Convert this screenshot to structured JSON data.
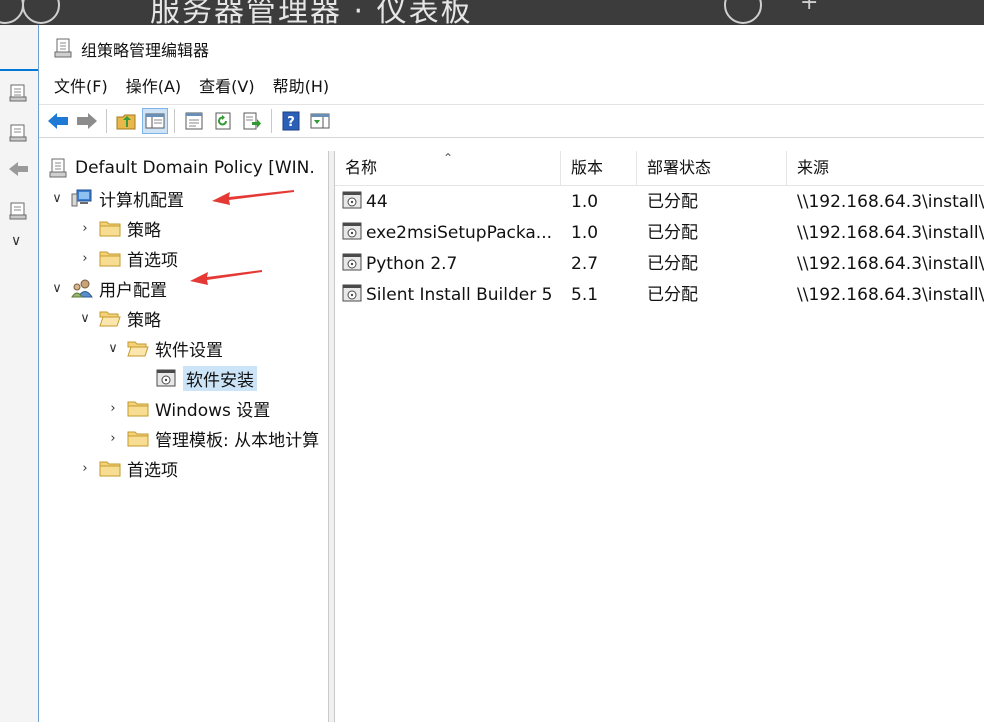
{
  "background_window": {
    "title": "服务器管理器 · 仪表板"
  },
  "window": {
    "title": "组策略管理编辑器"
  },
  "menu": [
    {
      "label": "文件(F)"
    },
    {
      "label": "操作(A)"
    },
    {
      "label": "查看(V)"
    },
    {
      "label": "帮助(H)"
    }
  ],
  "toolbar": {
    "buttons": [
      "back-icon",
      "forward-icon",
      "up-folder-icon",
      "show-hide-tree-icon",
      "properties-icon",
      "refresh-icon",
      "export-list-icon",
      "help-icon",
      "show-action-pane-icon"
    ]
  },
  "tree": {
    "root": "Default Domain Policy [WIN.",
    "computer_config": "计算机配置",
    "cc_policies": "策略",
    "cc_preferences": "首选项",
    "user_config": "用户配置",
    "uc_policies": "策略",
    "software_settings": "软件设置",
    "software_installation": "软件安装",
    "windows_settings": "Windows 设置",
    "admin_templates": "管理模板: 从本地计算",
    "uc_preferences": "首选项"
  },
  "list": {
    "columns": [
      "名称",
      "版本",
      "部署状态",
      "来源"
    ],
    "rows": [
      {
        "name": "44",
        "version": "1.0",
        "state": "已分配",
        "source": "\\\\192.168.64.3\\install\\"
      },
      {
        "name": "exe2msiSetupPacka...",
        "version": "1.0",
        "state": "已分配",
        "source": "\\\\192.168.64.3\\install\\"
      },
      {
        "name": "Python 2.7",
        "version": "2.7",
        "state": "已分配",
        "source": "\\\\192.168.64.3\\install\\"
      },
      {
        "name": "Silent Install Builder 5",
        "version": "5.1",
        "state": "已分配",
        "source": "\\\\192.168.64.3\\install\\"
      }
    ]
  },
  "colors": {
    "accent": "#0078d7",
    "selection": "#cce4f7",
    "annotation_arrow": "#e53935"
  }
}
